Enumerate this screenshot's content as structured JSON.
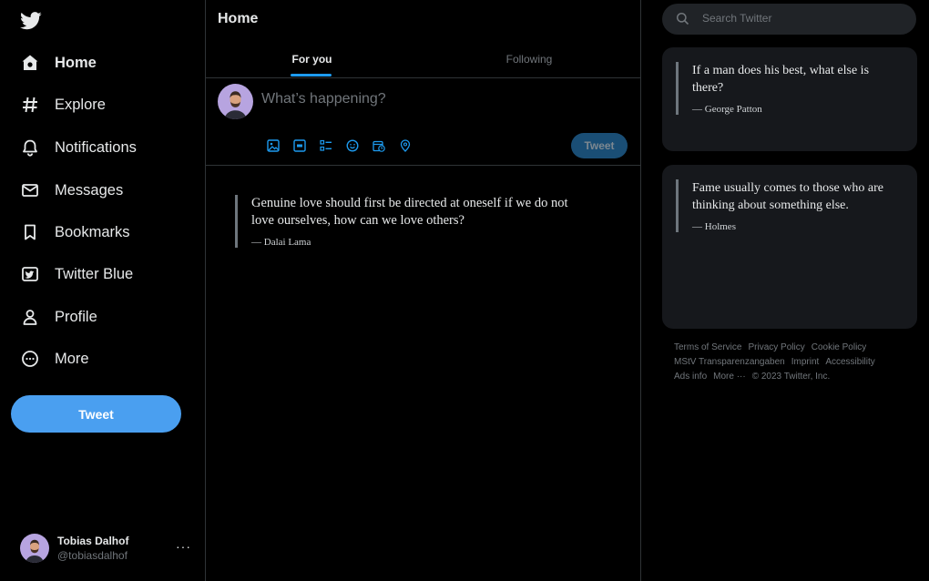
{
  "sidebar": {
    "logo_icon": "twitter-bird-icon",
    "items": [
      {
        "label": "Home",
        "icon": "home-icon",
        "active": true
      },
      {
        "label": "Explore",
        "icon": "hashtag-icon"
      },
      {
        "label": "Notifications",
        "icon": "bell-icon"
      },
      {
        "label": "Messages",
        "icon": "envelope-icon"
      },
      {
        "label": "Bookmarks",
        "icon": "bookmark-icon"
      },
      {
        "label": "Twitter Blue",
        "icon": "twitter-blue-icon"
      },
      {
        "label": "Profile",
        "icon": "person-icon"
      },
      {
        "label": "More",
        "icon": "more-circle-icon"
      }
    ],
    "tweet_label": "Tweet",
    "account": {
      "name": "Tobias Dalhof",
      "handle": "@tobiasdalhof",
      "more": "···"
    }
  },
  "main": {
    "title": "Home",
    "tabs": [
      {
        "label": "For you",
        "active": true
      },
      {
        "label": "Following"
      }
    ],
    "composer": {
      "placeholder": "What’s happening?",
      "tools": [
        "image-icon",
        "gif-icon",
        "poll-icon",
        "emoji-icon",
        "schedule-icon",
        "location-icon"
      ],
      "button_label": "Tweet"
    },
    "quote": {
      "text": "Genuine love should first be directed at oneself if we do not love ourselves, how can we love others?",
      "author": "— Dalai Lama"
    }
  },
  "right": {
    "search_placeholder": "Search Twitter",
    "cards": [
      {
        "text": "If a man does his best, what else is there?",
        "author": "— George Patton"
      },
      {
        "text": "Fame usually comes to those who are thinking about something else.",
        "author": "— Holmes"
      }
    ],
    "footer_links": [
      "Terms of Service",
      "Privacy Policy",
      "Cookie Policy",
      "MStV Transparenzangaben",
      "Imprint",
      "Accessibility",
      "Ads info",
      "More ···",
      "© 2023 Twitter, Inc."
    ]
  },
  "colors": {
    "background": "#000000",
    "accent": "#1d9bf0",
    "tweet_button": "#4a9ff0",
    "text": "#e7e9ea",
    "muted": "#71767b",
    "card": "#16181c"
  }
}
